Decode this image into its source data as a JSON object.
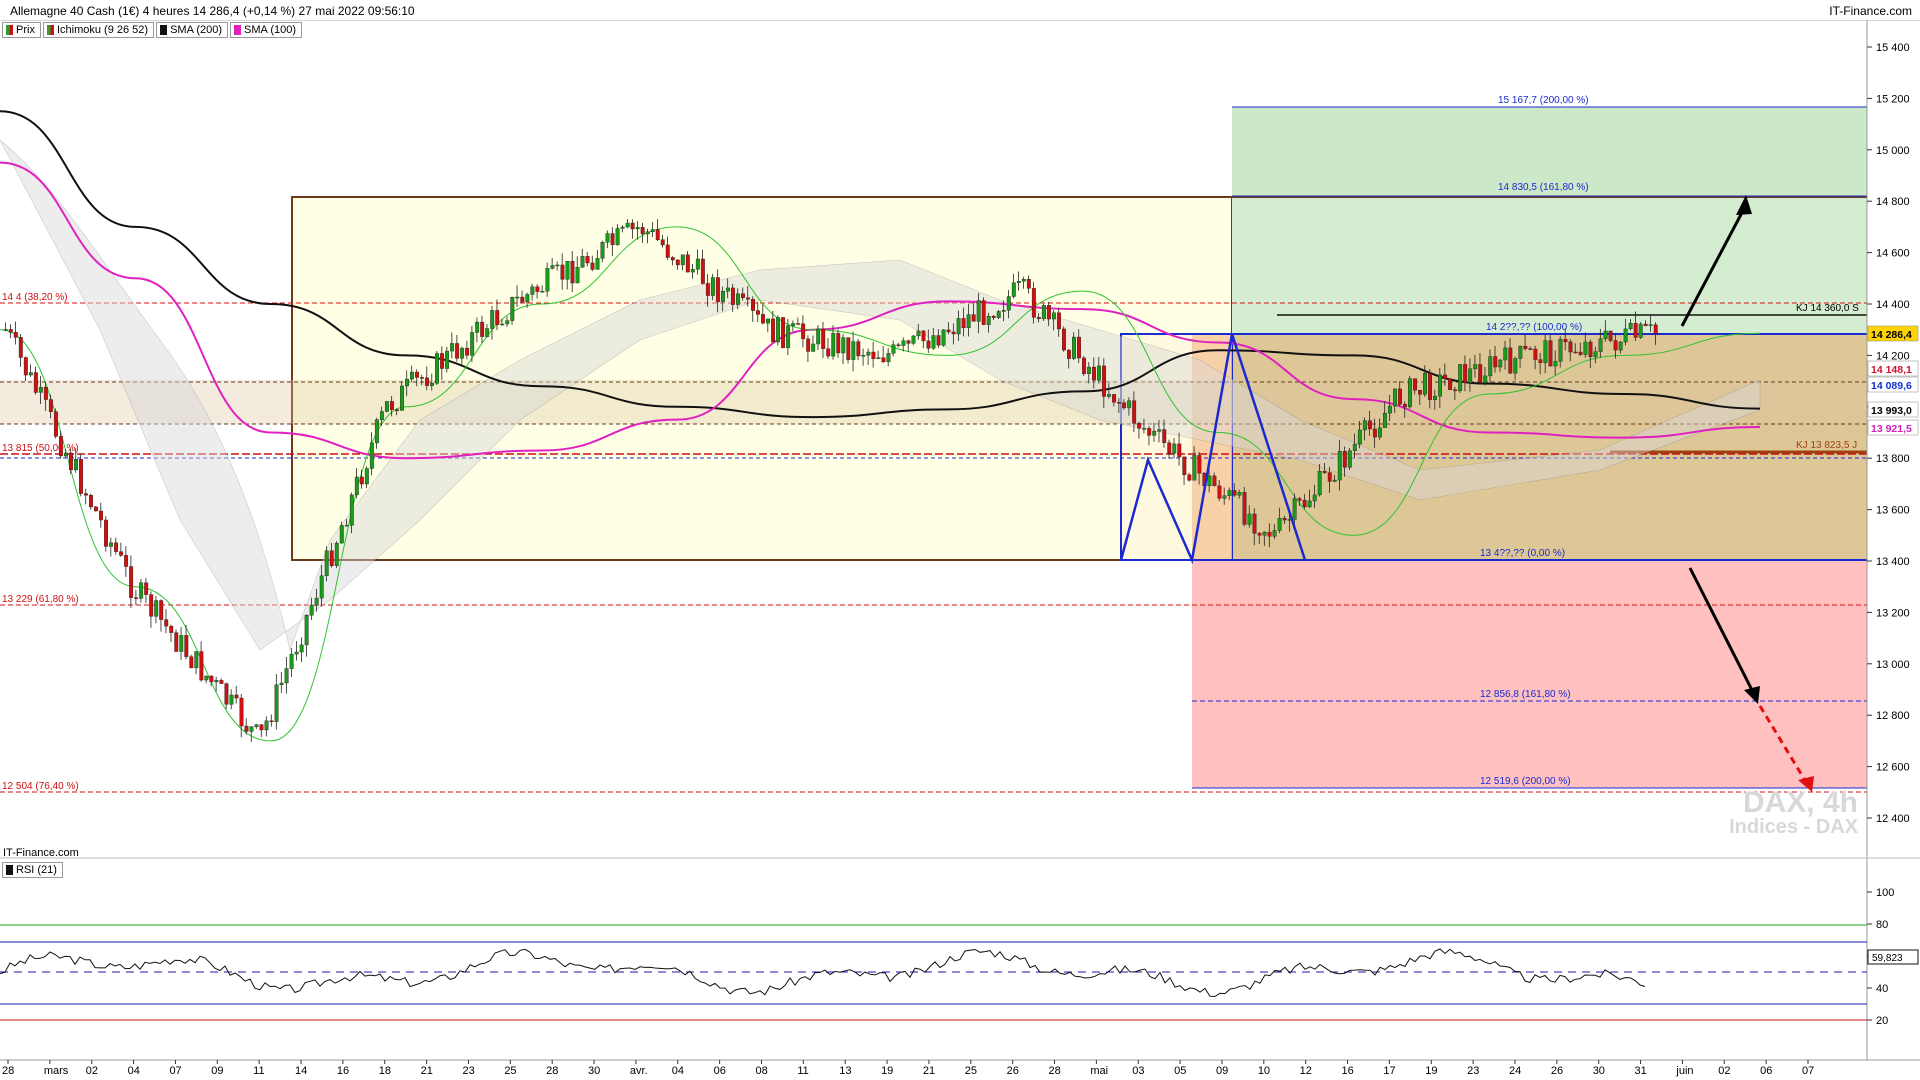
{
  "header": {
    "title": "Allemagne 40 Cash (1€) 4 heures 14 286,4 (+0,14 %) 27 mai 2022 09:56:10",
    "brand": "IT-Finance.com"
  },
  "legend": [
    {
      "label": "Prix",
      "color": "#2e9e2e"
    },
    {
      "label": "Ichimoku (9 26 52)",
      "color": "#2e9e2e"
    },
    {
      "label": "SMA (200)",
      "color": "#111111"
    },
    {
      "label": "SMA (100)",
      "color": "#e020c0"
    }
  ],
  "watermark": {
    "line1": "DAX, 4h",
    "line2": "Indices - DAX"
  },
  "credit": "IT-Finance.com",
  "rsi": {
    "label": "RSI (21)",
    "value": "59,823",
    "levels": [
      {
        "value": 80,
        "color": "#1aa31a"
      },
      {
        "value": 70,
        "color": "#1a1ab0"
      },
      {
        "value": 30,
        "color": "#1a1ab0"
      },
      {
        "value": 20,
        "color": "#d01010"
      }
    ],
    "ticks": [
      "100",
      "80",
      "60",
      "40",
      "20"
    ]
  },
  "price_axis": {
    "ticks": [
      "15 400",
      "15 200",
      "15 000",
      "14 800",
      "14 600",
      "14 400",
      "14 200",
      "14 000",
      "13 800",
      "13 600",
      "13 400",
      "13 200",
      "13 000",
      "12 800",
      "12 600",
      "12 400"
    ],
    "badges": [
      {
        "text": "14 286,4",
        "color": "#000000",
        "bg": "#ffd400"
      },
      {
        "text": "14 148,1",
        "color": "#d01030",
        "bg": "#ffffff"
      },
      {
        "text": "14 089,6",
        "color": "#1030d0",
        "bg": "#ffffff"
      },
      {
        "text": "13 993,0",
        "color": "#000000",
        "bg": "#ffffff"
      },
      {
        "text": "13 921,5",
        "color": "#d020c0",
        "bg": "#ffffff"
      }
    ]
  },
  "x_axis": [
    "28",
    "mars",
    "02",
    "04",
    "07",
    "09",
    "11",
    "14",
    "16",
    "18",
    "21",
    "23",
    "25",
    "28",
    "30",
    "avr.",
    "04",
    "06",
    "08",
    "11",
    "13",
    "19",
    "21",
    "25",
    "26",
    "28",
    "mai",
    "03",
    "05",
    "09",
    "10",
    "12",
    "16",
    "17",
    "19",
    "23",
    "24",
    "26",
    "30",
    "31",
    "juin",
    "02",
    "06",
    "07"
  ],
  "annotations": {
    "fib_left": [
      {
        "text": "14 4",
        "sub": "(38,20 %)"
      },
      {
        "text": "13 815",
        "sub": "(50,00 %)"
      },
      {
        "text": "13 229",
        "sub": "(61,80 %)"
      },
      {
        "text": "12 504",
        "sub": "(76,40 %)"
      }
    ],
    "targets_up": [
      "15 167,7 (200,00 %)",
      "14 830,5 (161,80 %)",
      "14 2??,?? (100,00 %)"
    ],
    "targets_down": [
      "13 4??,?? (0,00 %)",
      "12 856,8 (161,80 %)",
      "12 519,6 (200,00 %)"
    ],
    "kj_top": "KJ 14 360,0 S",
    "kj_bottom": "KJ 13 823,5 J"
  },
  "chart_data": {
    "type": "line",
    "title": "Allemagne 40 Cash (1€) 4 heures",
    "xlabel": "",
    "ylabel": "",
    "ylim": [
      12300,
      15450
    ],
    "last_price": 14286.4,
    "change_pct": 0.14,
    "series": [
      {
        "name": "SMA (200)",
        "values": [
          15150,
          14700,
          14400,
          14200,
          14080,
          14000,
          13960,
          13990,
          14060,
          14220,
          14200,
          14090,
          14050,
          13993
        ]
      },
      {
        "name": "SMA (100)",
        "values": [
          14950,
          14500,
          13900,
          13800,
          13830,
          13950,
          14300,
          14410,
          14380,
          14250,
          14030,
          13900,
          13880,
          13921.5
        ]
      },
      {
        "name": "Ichimoku (9 26 52)",
        "values": [
          14300,
          13300,
          12700,
          14000,
          14400,
          14700,
          14300,
          14200,
          14450,
          13900,
          13500,
          14050,
          14200,
          14286.4
        ]
      }
    ],
    "levels": [
      15167.7,
      14830.5,
      14286.4,
      13400,
      12856.8,
      12519.6
    ]
  }
}
